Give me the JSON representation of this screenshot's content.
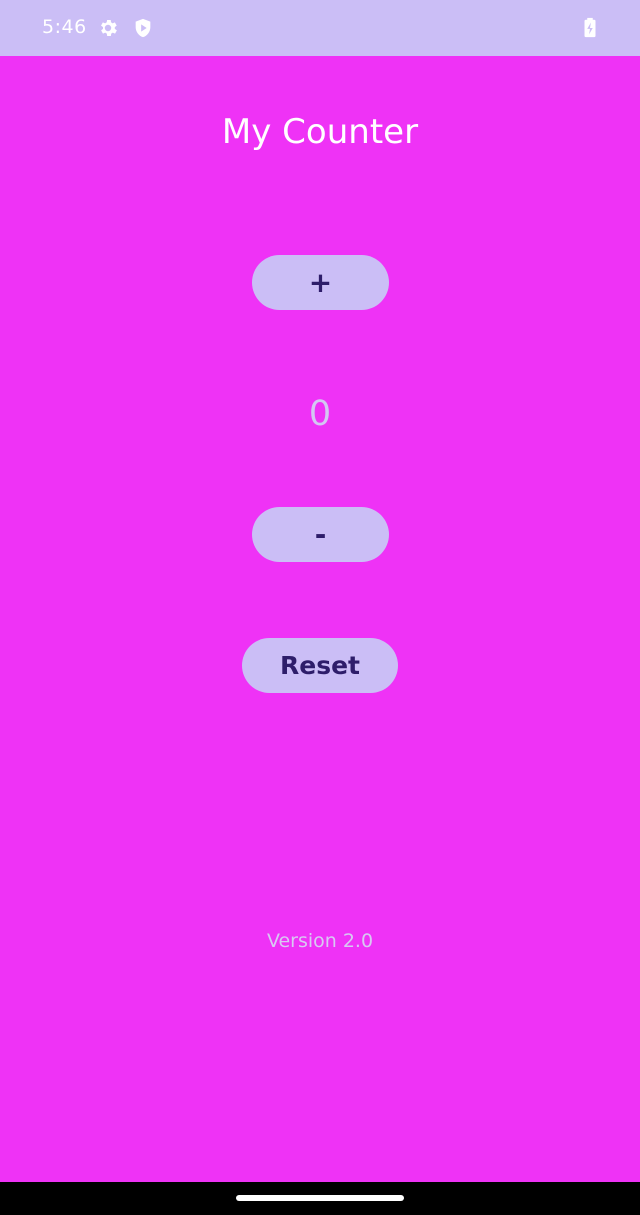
{
  "status_bar": {
    "time": "5:46",
    "icons": [
      "gear-icon",
      "play-shield-icon",
      "battery-charging-icon"
    ],
    "color": "#CBBEF6"
  },
  "app": {
    "title": "My Counter",
    "background_color": "#EF32F6"
  },
  "counter": {
    "value": "0",
    "increment_label": "+",
    "decrement_label": "-",
    "reset_label": "Reset"
  },
  "footer": {
    "version": "Version 2.0"
  },
  "colors": {
    "accent": "#CBBEF6",
    "button_text": "#2E1D6A"
  }
}
